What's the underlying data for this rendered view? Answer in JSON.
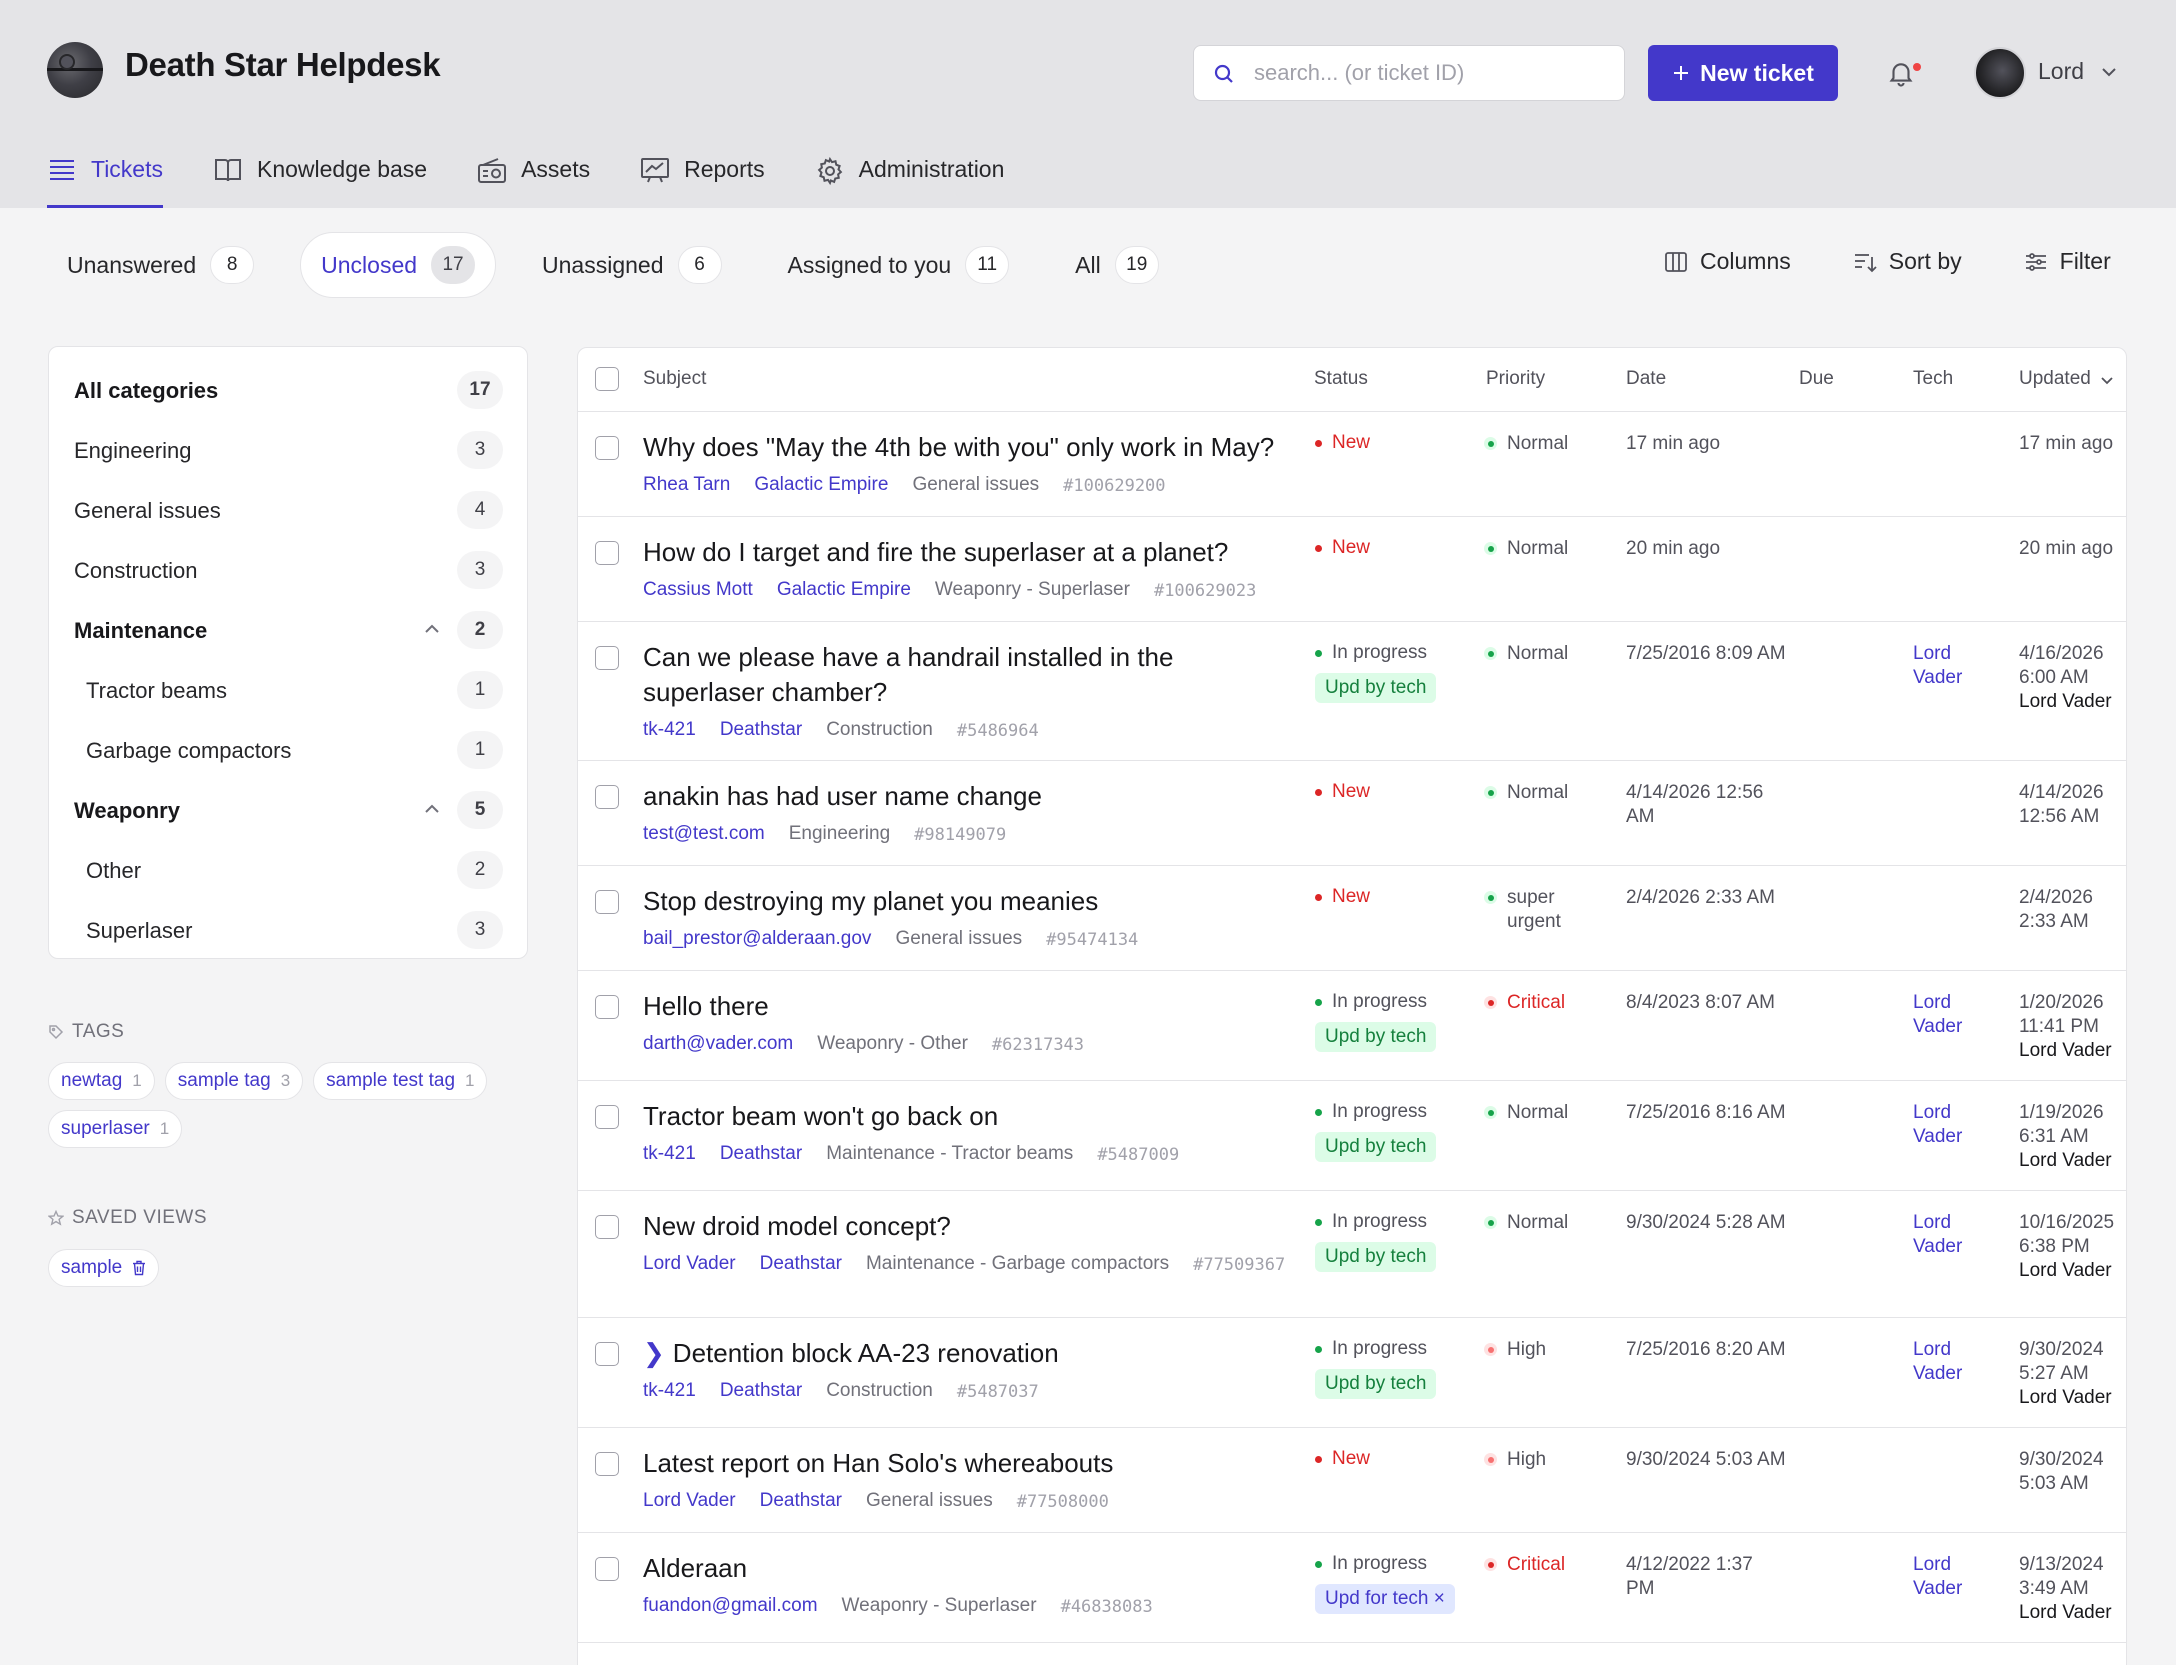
{
  "app": {
    "title": "Death Star Helpdesk"
  },
  "search": {
    "placeholder": "search... (or ticket ID)"
  },
  "header": {
    "new_ticket": "New ticket",
    "user": "Lord"
  },
  "nav": {
    "tickets": "Tickets",
    "kb": "Knowledge base",
    "assets": "Assets",
    "reports": "Reports",
    "admin": "Administration"
  },
  "filters": [
    {
      "label": "Unanswered",
      "count": "8"
    },
    {
      "label": "Unclosed",
      "count": "17"
    },
    {
      "label": "Unassigned",
      "count": "6"
    },
    {
      "label": "Assigned to you",
      "count": "11"
    },
    {
      "label": "All",
      "count": "19"
    }
  ],
  "tools": {
    "columns": "Columns",
    "sort": "Sort by",
    "filter": "Filter"
  },
  "categories": [
    {
      "label": "All categories",
      "count": "17"
    },
    {
      "label": "Engineering",
      "count": "3"
    },
    {
      "label": "General issues",
      "count": "4"
    },
    {
      "label": "Construction",
      "count": "3"
    },
    {
      "label": "Maintenance",
      "count": "2"
    },
    {
      "label": "Tractor beams",
      "count": "1"
    },
    {
      "label": "Garbage compactors",
      "count": "1"
    },
    {
      "label": "Weaponry",
      "count": "5"
    },
    {
      "label": "Other",
      "count": "2"
    },
    {
      "label": "Superlaser",
      "count": "3"
    }
  ],
  "tags_heading": "TAGS",
  "tags": [
    {
      "label": "newtag",
      "count": "1"
    },
    {
      "label": "sample tag",
      "count": "3"
    },
    {
      "label": "sample test tag",
      "count": "1"
    },
    {
      "label": "superlaser",
      "count": "1"
    }
  ],
  "views_heading": "SAVED VIEWS",
  "views": [
    {
      "label": "sample"
    }
  ],
  "columns": {
    "subject": "Subject",
    "status": "Status",
    "priority": "Priority",
    "date": "Date",
    "due": "Due",
    "tech": "Tech",
    "updated": "Updated"
  },
  "tickets": [
    {
      "subject": "Why does \"May the 4th be with you\" only work in May?",
      "user": "Rhea Tarn",
      "company": "Galactic Empire",
      "category": "General issues",
      "id": "#100629200",
      "status": "New",
      "priority": "Normal",
      "date": "17 min ago",
      "tech": "",
      "updated": "17 min ago",
      "updated_by": ""
    },
    {
      "subject": "How do I target and fire the superlaser at a planet?",
      "user": "Cassius Mott",
      "company": "Galactic Empire",
      "category": "Weaponry - Superlaser",
      "id": "#100629023",
      "status": "New",
      "priority": "Normal",
      "date": "20 min ago",
      "tech": "",
      "updated": "20 min ago",
      "updated_by": ""
    },
    {
      "subject": "Can we please have a handrail installed in the superlaser chamber?",
      "user": "tk-421",
      "company": "Deathstar",
      "category": "Construction",
      "id": "#5486964",
      "status": "In progress",
      "badge": "Upd by tech",
      "priority": "Normal",
      "date": "7/25/2016 8:09 AM",
      "tech": "Lord Vader",
      "updated": "4/16/2026 6:00 AM",
      "updated_by": "Lord Vader"
    },
    {
      "subject": "anakin has had user name change",
      "user": "test@test.com",
      "company": "",
      "category": "Engineering",
      "id": "#98149079",
      "status": "New",
      "priority": "Normal",
      "date": "4/14/2026 12:56 AM",
      "tech": "",
      "updated": "4/14/2026 12:56 AM",
      "updated_by": ""
    },
    {
      "subject": "Stop destroying my planet you meanies",
      "user": "bail_prestor@alderaan.gov",
      "company": "",
      "category": "General issues",
      "id": "#95474134",
      "status": "New",
      "priority": "super urgent",
      "date": "2/4/2026 2:33 AM",
      "tech": "",
      "updated": "2/4/2026 2:33 AM",
      "updated_by": ""
    },
    {
      "subject": "Hello there",
      "user": "darth@vader.com",
      "company": "",
      "category": "Weaponry - Other",
      "id": "#62317343",
      "status": "In progress",
      "badge": "Upd by tech",
      "priority": "Critical",
      "date": "8/4/2023 8:07 AM",
      "tech": "Lord Vader",
      "updated": "1/20/2026 11:41 PM",
      "updated_by": "Lord Vader"
    },
    {
      "subject": "Tractor beam won't go back on",
      "user": "tk-421",
      "company": "Deathstar",
      "category": "Maintenance - Tractor beams",
      "id": "#5487009",
      "status": "In progress",
      "badge": "Upd by tech",
      "priority": "Normal",
      "date": "7/25/2016 8:16 AM",
      "tech": "Lord Vader",
      "updated": "1/19/2026 6:31 AM",
      "updated_by": "Lord Vader"
    },
    {
      "subject": "New droid model concept?",
      "user": "Lord Vader",
      "company": "Deathstar",
      "category": "Maintenance - Garbage compactors",
      "id": "#77509367",
      "status": "In progress",
      "badge": "Upd by tech",
      "priority": "Normal",
      "date": "9/30/2024 5:28 AM",
      "tech": "Lord Vader",
      "updated": "10/16/2025 6:38 PM",
      "updated_by": "Lord Vader"
    },
    {
      "subject": "Detention block AA-23 renovation",
      "user": "tk-421",
      "company": "Deathstar",
      "category": "Construction",
      "id": "#5487037",
      "status": "In progress",
      "badge": "Upd by tech",
      "priority": "High",
      "date": "7/25/2016 8:20 AM",
      "tech": "Lord Vader",
      "updated": "9/30/2024 5:27 AM",
      "updated_by": "Lord Vader"
    },
    {
      "subject": "Latest report on Han Solo's whereabouts",
      "user": "Lord Vader",
      "company": "Deathstar",
      "category": "General issues",
      "id": "#77508000",
      "status": "New",
      "priority": "High",
      "date": "9/30/2024 5:03 AM",
      "tech": "",
      "updated": "9/30/2024 5:03 AM",
      "updated_by": ""
    },
    {
      "subject": "Alderaan",
      "user": "fuandon@gmail.com",
      "company": "",
      "category": "Weaponry - Superlaser",
      "id": "#46838083",
      "status": "In progress",
      "badge": "Upd for tech ×",
      "priority": "Critical",
      "date": "4/12/2022 1:37 PM",
      "tech": "Lord Vader",
      "updated": "9/13/2024 3:49 AM",
      "updated_by": "Lord Vader"
    }
  ]
}
